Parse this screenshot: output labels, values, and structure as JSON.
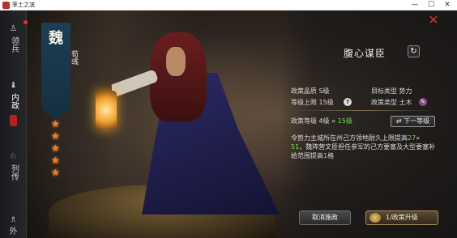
{
  "window": {
    "title": "率土之滨",
    "minimize": "—",
    "maximize": "☐",
    "close": "✕"
  },
  "sidebar": {
    "items": [
      {
        "label": "领兵",
        "icon": "soldier-icon",
        "glyph": "♙"
      },
      {
        "label": "内政",
        "icon": "governance-icon",
        "glyph": "♝",
        "active": true
      },
      {
        "label": "列传",
        "icon": "biography-icon",
        "glyph": "♘"
      },
      {
        "label": "外",
        "icon": "diplomacy-icon",
        "glyph": "♗"
      }
    ]
  },
  "faction": {
    "char": "魏",
    "general_name": "荀彧",
    "stars": 5
  },
  "policy": {
    "title": "腹心谋臣",
    "refresh_glyph": "↻",
    "quality_label": "政策品质 S级",
    "target_type_label": "目标类型 势力",
    "max_level_label": "等级上限 15级",
    "policy_type_label": "政策类型 土木",
    "help_glyph": "?",
    "type_glyph": "✎",
    "level_label": "政策等级 4级",
    "level_arrow": "»",
    "next_level": "15级",
    "next_level_button": "⇄ 下一等级",
    "description": {
      "part1": "令势力主城所在州己方领地耐久上限提高",
      "value1_a": "27",
      "value1_arrow": "»",
      "value1_b": "51",
      "part2": "，魏阵营文臣担任参军的己方要塞及大型要塞补给范围提高",
      "value2": "1",
      "part3": "格"
    }
  },
  "actions": {
    "cancel_label": "取消施政",
    "upgrade_label": "1/政策升级"
  },
  "colors": {
    "highlight": "#7bd862",
    "close_red": "#c0392b",
    "star_orange": "#ff7a20",
    "banner_blue": "#1d3e54"
  }
}
